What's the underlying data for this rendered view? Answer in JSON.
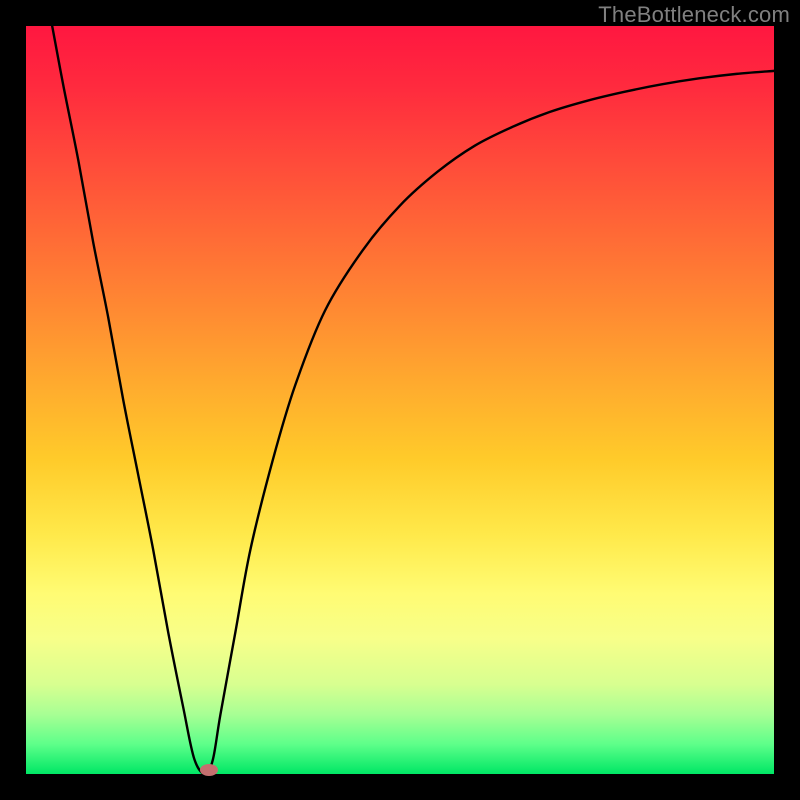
{
  "watermark": "TheBottleneck.com",
  "colors": {
    "frame": "#000000",
    "curve": "#000000",
    "marker": "#c46f6f",
    "watermark": "#808080"
  },
  "chart_data": {
    "type": "line",
    "title": "",
    "xlabel": "",
    "ylabel": "",
    "xlim": [
      0,
      100
    ],
    "ylim": [
      0,
      100
    ],
    "x": [
      3.5,
      5,
      7,
      9,
      11,
      13,
      15,
      17,
      19,
      21,
      22.5,
      24,
      25,
      26,
      28,
      30,
      33,
      36,
      40,
      45,
      50,
      55,
      60,
      65,
      70,
      75,
      80,
      85,
      90,
      95,
      100
    ],
    "y": [
      100,
      92,
      82,
      71,
      61,
      50,
      40,
      30,
      19,
      9,
      2,
      0,
      2,
      8,
      19,
      30,
      42,
      52,
      62,
      70,
      76,
      80.5,
      84,
      86.5,
      88.5,
      90,
      91.2,
      92.2,
      93,
      93.6,
      94
    ],
    "marker": {
      "x": 24.5,
      "y": 0.5
    },
    "note": "V-shaped curve reaching minimum near x≈24; x and y are percentages of plot width/height (y=0 is bottom)."
  }
}
